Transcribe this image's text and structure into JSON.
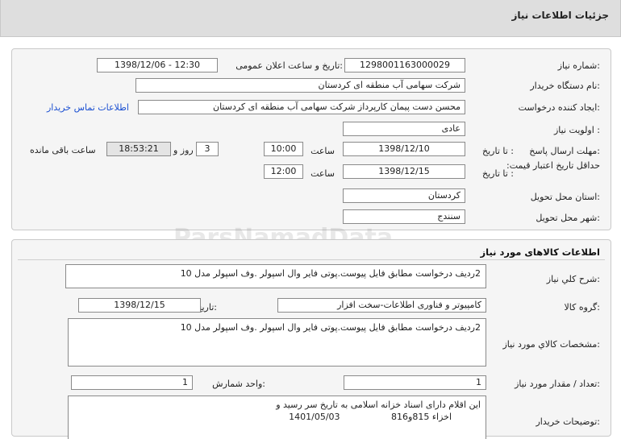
{
  "header": {
    "title": "جزئیات اطلاعات نیاز"
  },
  "info": {
    "need_number_label": "شماره نیاز:",
    "need_number": "1298001163000029",
    "announce_label": "تاریخ و ساعت اعلان عمومی:",
    "announce_value": "1398/12/06 - 12:30",
    "buyer_label": "نام دستگاه خریدار:",
    "buyer_value": "شرکت سهامی آب منطقه ای کردستان",
    "creator_label": "ایجاد کننده درخواست:",
    "creator_value": "محسن دست پیمان کارپرداز شرکت سهامی آب منطقه ای کردستان",
    "contact_link": "اطلاعات تماس خریدار",
    "priority_label": "اولویت نیاز :",
    "priority_value": "عادی",
    "reply_deadline_label": "مهلت ارسال پاسخ:",
    "to_date_label": "تا تاریخ :",
    "reply_date": "1398/12/10",
    "time_label": "ساعت",
    "reply_time": "10:00",
    "days_value": "3",
    "days_label": "روز و",
    "remaining_time": "18:53:21",
    "remaining_label": "ساعت باقی مانده",
    "validity_label": "حداقل تاریخ اعتبار قیمت:",
    "validity_date": "1398/12/15",
    "validity_time": "12:00",
    "province_label": "استان محل تحویل:",
    "province_value": "کردستان",
    "city_label": "شهر محل تحویل:",
    "city_value": "سنندج"
  },
  "goods": {
    "section_title": "اطلاعات کالاهای مورد نیاز",
    "summary_label": "شرح کلي نياز:",
    "summary_value": "2ردیف درخواست مطابق فایل پیوست.پوتی فایر وال اسپولر .وف اسپولر مدل 10",
    "group_label": "گروه کالا:",
    "group_value": "کامپیوتر و فناوری اطلاعات-سخت افزار",
    "need_date_label": "تاریخ نیاز به کالا:",
    "need_date_value": "1398/12/15",
    "spec_label": "مشخصات کالاي مورد نياز:",
    "spec_value": "2ردیف درخواست مطابق فایل پیوست.پوتی فایر وال اسپولر .وف اسپولر مدل 10",
    "qty_label": "تعداد / مقدار مورد نیاز:",
    "qty_value": "1",
    "unit_label": "واحد شمارش:",
    "unit_value": "1",
    "buyer_notes_label": "توضیحات خریدار:",
    "buyer_notes_line1": "این اقلام دارای اسناد خزانه اسلامی به تاریخ سر رسید و",
    "buyer_notes_line2_a": "اخزاء  815و816",
    "buyer_notes_line2_b": "1401/05/03"
  }
}
